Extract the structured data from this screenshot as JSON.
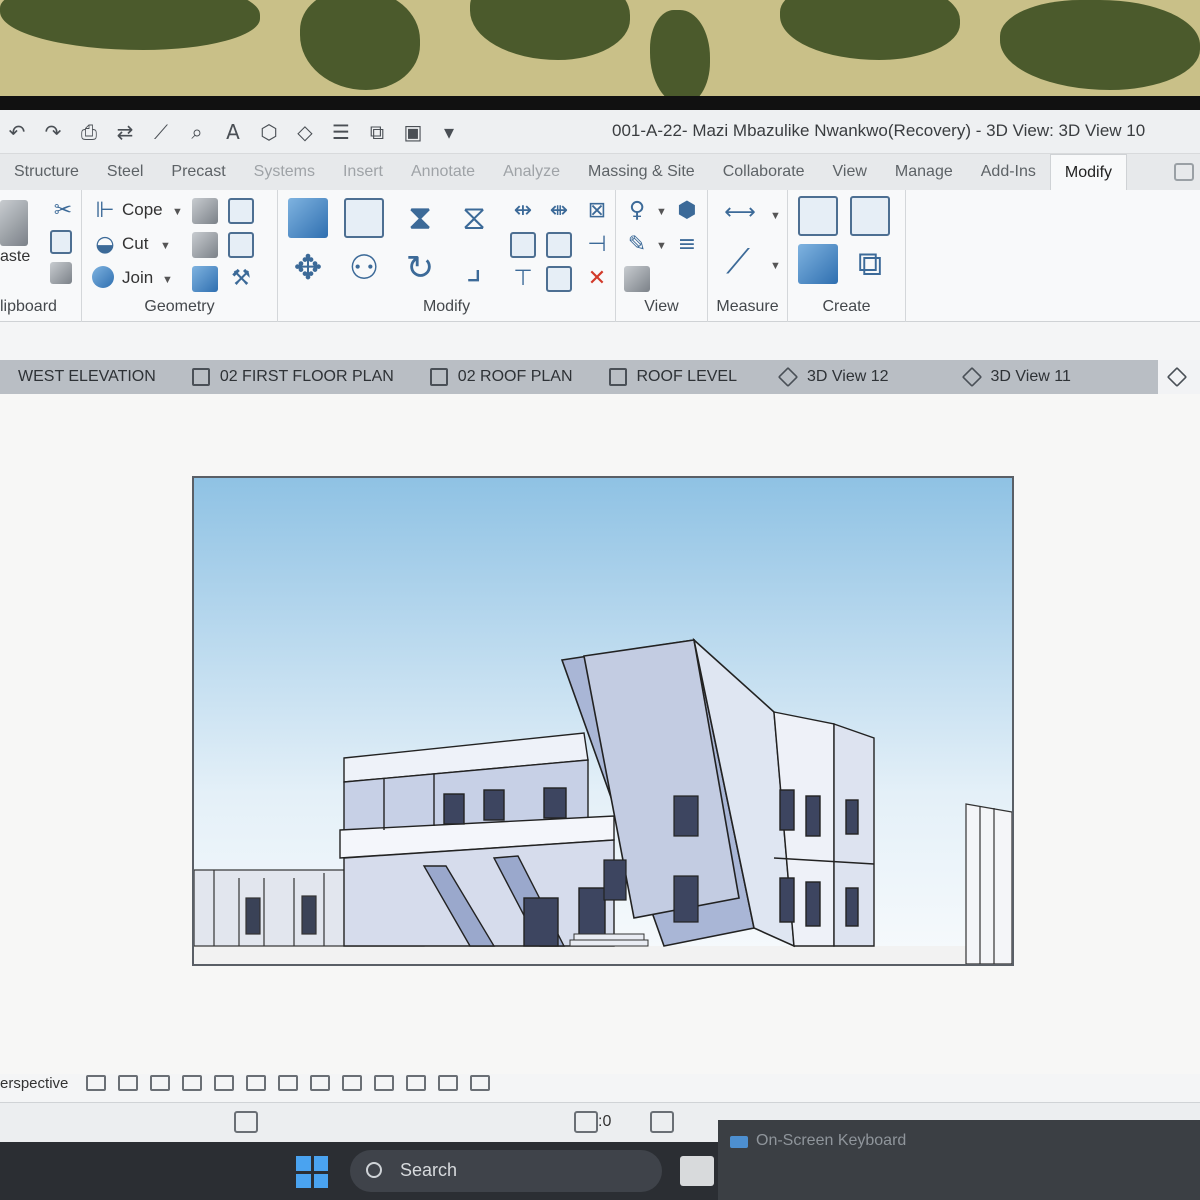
{
  "window": {
    "title": "001-A-22- Mazi Mbazulike Nwankwo(Recovery) - 3D View: 3D View 10"
  },
  "ribbon_tabs": [
    {
      "label": "Structure",
      "state": "normal"
    },
    {
      "label": "Steel",
      "state": "normal"
    },
    {
      "label": "Precast",
      "state": "normal"
    },
    {
      "label": "Systems",
      "state": "faded"
    },
    {
      "label": "Insert",
      "state": "faded"
    },
    {
      "label": "Annotate",
      "state": "faded"
    },
    {
      "label": "Analyze",
      "state": "faded"
    },
    {
      "label": "Massing & Site",
      "state": "normal"
    },
    {
      "label": "Collaborate",
      "state": "normal"
    },
    {
      "label": "View",
      "state": "normal"
    },
    {
      "label": "Manage",
      "state": "normal"
    },
    {
      "label": "Add-Ins",
      "state": "normal"
    },
    {
      "label": "Modify",
      "state": "active"
    }
  ],
  "ribbon": {
    "clipboard": {
      "paste_label": "aste",
      "panel_label": "lipboard"
    },
    "geometry": {
      "cope_label": "Cope",
      "cut_label": "Cut",
      "join_label": "Join",
      "panel_label": "Geometry"
    },
    "modify": {
      "panel_label": "Modify"
    },
    "view": {
      "panel_label": "View"
    },
    "measure": {
      "panel_label": "Measure"
    },
    "create": {
      "panel_label": "Create"
    }
  },
  "view_tabs": [
    {
      "label": "WEST ELEVATION",
      "icon": "elevation-icon"
    },
    {
      "label": "02 FIRST FLOOR PLAN",
      "icon": "floor-plan-icon"
    },
    {
      "label": "02 ROOF PLAN",
      "icon": "floor-plan-icon"
    },
    {
      "label": "ROOF LEVEL",
      "icon": "floor-plan-icon"
    },
    {
      "label": "3D View 12",
      "icon": "3d-cube-icon"
    },
    {
      "label": "3D View 11",
      "icon": "3d-cube-icon"
    }
  ],
  "view_control_bar": {
    "mode_label": "erspective"
  },
  "status_bar": {
    "selection_count": ":0"
  },
  "taskbar": {
    "search_label": "Search"
  },
  "on_screen_keyboard": {
    "title": "On-Screen Keyboard"
  },
  "colors": {
    "sky_top": "#8fc2e4",
    "sky_bottom": "#f2f7fb",
    "building_fill": "#dfe6f2",
    "building_shade": "#a9b6d6",
    "ribbon_bg": "#f8f9fa",
    "view_tabs_bg": "#b9bec4"
  }
}
